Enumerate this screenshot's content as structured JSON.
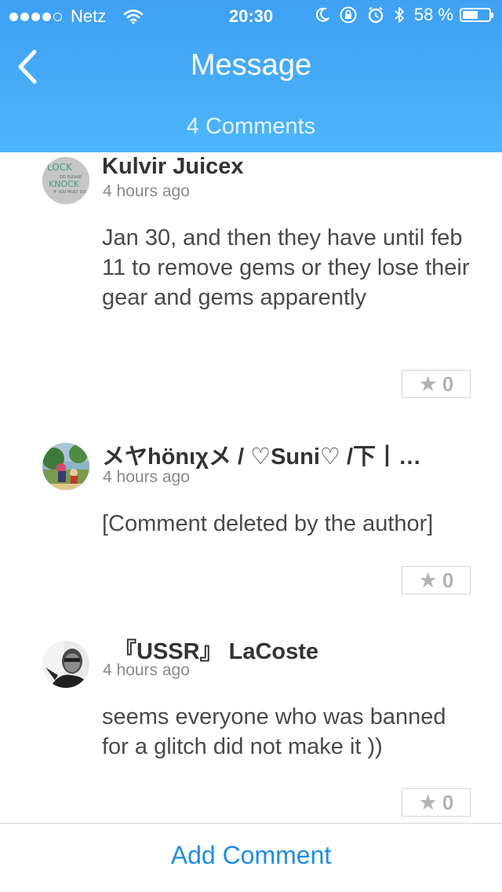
{
  "status_bar": {
    "carrier": "Netz",
    "time": "20:30",
    "battery_percent": "58 %",
    "battery_level": 0.58,
    "signal_bars": 4,
    "signal_max": 5
  },
  "nav": {
    "title": "Message",
    "back_icon": "chevron-left-icon",
    "comment_count": "4 Comments"
  },
  "comments": [
    {
      "author": "Kulvir Juicex",
      "time": "4 hours ago",
      "body": "Jan 30, and then they have until feb 11 to remove gems or they lose their gear and gems apparently",
      "likes": "0",
      "avatar_label": "LOCK\nDO PLEASE\nKNOCK\nIF YOU MUST DO"
    },
    {
      "author": "メヤhönιχメ / ♡Suni♡ /下丨…",
      "time": "4 hours ago",
      "body": "[Comment deleted by the author]",
      "likes": "0"
    },
    {
      "author": "『USSR』 LaCoste",
      "time": "4 hours ago",
      "body": "seems everyone who was banned for a glitch did not make it ))",
      "likes": "0"
    }
  ],
  "footer": {
    "add_comment_label": "Add Comment"
  },
  "colors": {
    "header_bg": "#45abf7",
    "accent": "#1f8de4",
    "author_text": "#333333",
    "muted_text": "#8a8a8a"
  }
}
